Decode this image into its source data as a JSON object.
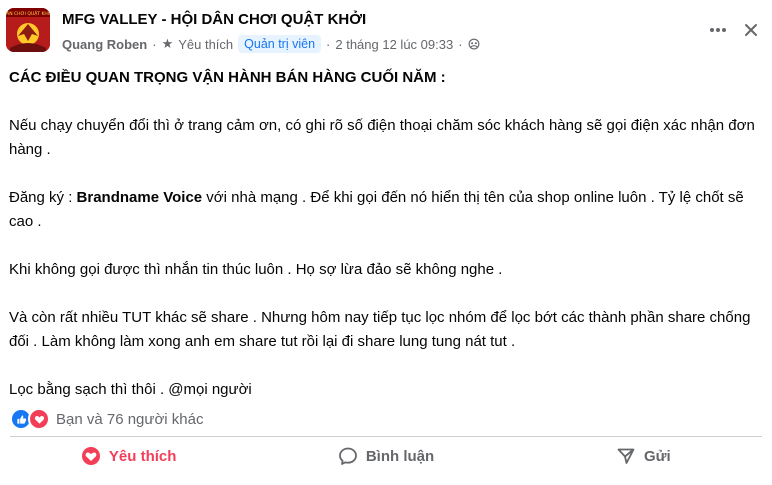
{
  "header": {
    "group_name": "MFG VALLEY - HỘI DÂN CHƠI QUẬT KHỞI",
    "author": "Quang Roben",
    "star_label": "Yêu thích",
    "role_badge": "Quản trị viên",
    "separator": "·",
    "timestamp": "2 tháng 12 lúc 09:33",
    "avatar_banner_text": "DÂN CHƠI QUẬT KHỞI"
  },
  "post": {
    "title": "CÁC ĐIỀU QUAN TRỌNG VẬN HÀNH BÁN HÀNG CUỐI NĂM :",
    "p1": "Nếu chạy chuyển đổi thì ở trang cảm ơn, có ghi rõ số điện thoại chăm sóc khách hàng sẽ gọi điện xác nhận đơn hàng .",
    "p2_before": "Đăng ký : ",
    "p2_bold": "Brandname Voice",
    "p2_after": " với nhà mạng . Để khi gọi đến nó hiển thị tên của shop online luôn . Tỷ lệ chốt sẽ cao .",
    "p3": "Khi không gọi được thì nhắn tin thúc luôn . Họ sợ lừa đảo sẽ không nghe .",
    "p4": "Và còn rất nhiều TUT khác sẽ share . Nhưng hôm nay tiếp tục lọc nhóm để lọc bớt các thành phần share chống đối . Làm không làm xong anh em share tut rồi lại đi share lung tung nát tut .",
    "p5": "Lọc bằng sạch thì thôi . @mọi người"
  },
  "reactions": {
    "summary": "Bạn và 76 người khác",
    "icons": [
      "like-icon",
      "love-icon"
    ]
  },
  "actions": {
    "like_label": "Yêu thích",
    "comment_label": "Bình luận",
    "share_label": "Gửi"
  },
  "colors": {
    "text": "#050505",
    "secondary": "#65676b",
    "accent_blue": "#1877f2",
    "love_red": "#f33e58",
    "badge_bg": "#e7f3ff"
  }
}
